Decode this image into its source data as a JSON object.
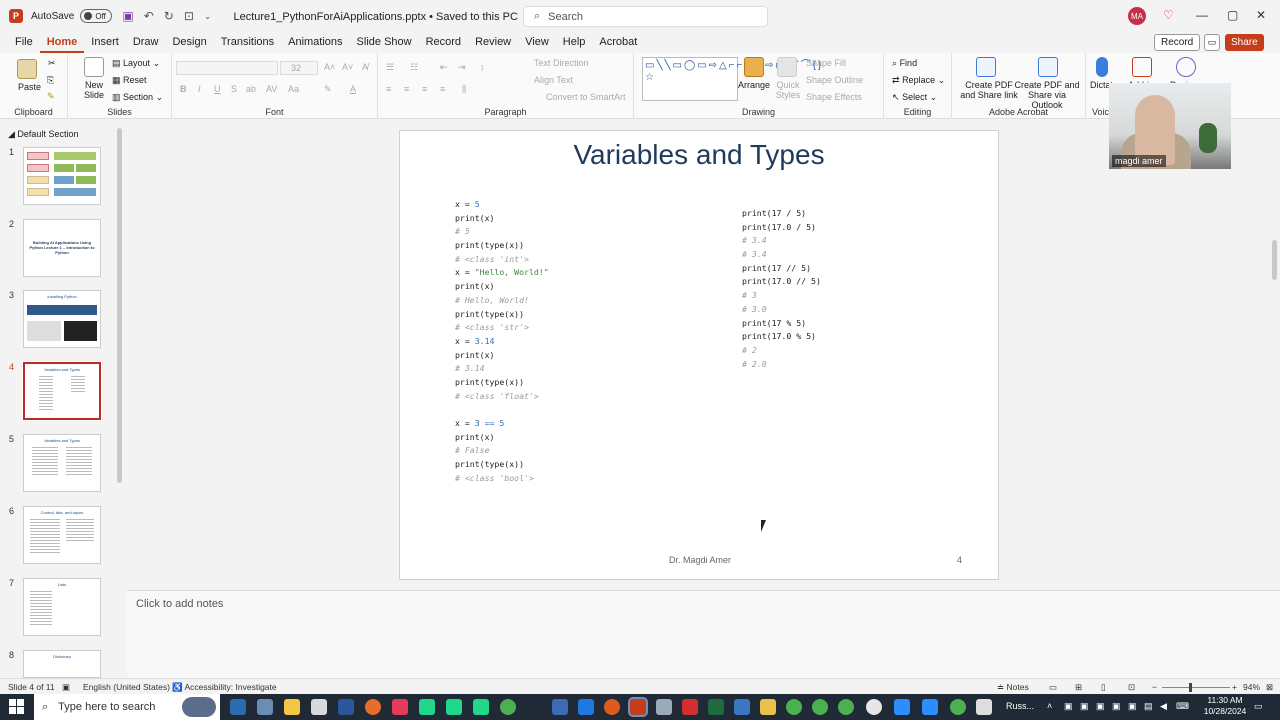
{
  "titlebar": {
    "autosave_label": "AutoSave",
    "autosave_state": "Off",
    "doc_title": "Lecture1_PythonForAiApplications.pptx  •  Saved to this PC  ⌄",
    "search_placeholder": "Search",
    "user_initials": "MA"
  },
  "tabs": [
    "File",
    "Home",
    "Insert",
    "Draw",
    "Design",
    "Transitions",
    "Animations",
    "Slide Show",
    "Record",
    "Review",
    "View",
    "Help",
    "Acrobat"
  ],
  "active_tab": "Home",
  "tab_actions": {
    "record": "Record",
    "share": "Share"
  },
  "ribbon": {
    "clipboard": {
      "label": "Clipboard",
      "paste": "Paste"
    },
    "slides": {
      "label": "Slides",
      "new_slide": "New Slide",
      "layout": "Layout",
      "reset": "Reset",
      "section": "Section"
    },
    "font": {
      "label": "Font",
      "size": "32"
    },
    "paragraph": {
      "label": "Paragraph",
      "text_direction": "Text Direction",
      "align_text": "Align Text",
      "smartart": "Convert to SmartArt"
    },
    "drawing": {
      "label": "Drawing",
      "arrange": "Arrange",
      "quick_styles": "Quick Styles",
      "shape_fill": "Shape Fill",
      "shape_outline": "Shape Outline",
      "shape_effects": "Shape Effects"
    },
    "editing": {
      "label": "Editing",
      "find": "Find",
      "replace": "Replace",
      "select": "Select"
    },
    "acrobat": {
      "label": "Adobe Acrobat",
      "create_pdf_share": "Create PDF and Share link",
      "create_pdf_outlook": "Create PDF and Share via Outlook"
    },
    "voice": {
      "label": "Voice",
      "dictate": "Dictate",
      "addins": "Add-ins",
      "designer": "Designer"
    }
  },
  "thumbnails": {
    "section": "Default Section",
    "slides": [
      {
        "num": "1",
        "title": ""
      },
      {
        "num": "2",
        "title": "Building AI Applications Using Python Lecture 1 – Introduction to Python"
      },
      {
        "num": "3",
        "title": "Installing Python"
      },
      {
        "num": "4",
        "title": "Variables and Types"
      },
      {
        "num": "5",
        "title": "Variables and Types"
      },
      {
        "num": "6",
        "title": "Control, lists, and tuples"
      },
      {
        "num": "7",
        "title": "Lists"
      },
      {
        "num": "8",
        "title": "Dictionary"
      }
    ],
    "active": "4"
  },
  "slide": {
    "title": "Variables and Types",
    "left_code": [
      {
        "t": "x = ",
        "n": "5"
      },
      {
        "t": "print(x)"
      },
      {
        "c": "# 5"
      },
      {
        "t": "print(type(x))"
      },
      {
        "c": "# <class 'int'>"
      },
      {
        "t": "x = ",
        "s": "\"Hello, World!\""
      },
      {
        "t": "print(x)"
      },
      {
        "c": "# Hello, World!"
      },
      {
        "t": "print(type(x))"
      },
      {
        "c": "# <class 'str'>"
      },
      {
        "t": "x = ",
        "n": "3.14"
      },
      {
        "t": "print(x)"
      },
      {
        "c": "# 3.14"
      },
      {
        "t": "print(type(x))"
      },
      {
        "c": "# <class 'float'>"
      },
      {
        "t": ""
      },
      {
        "t": "x = ",
        "n": "3 == 5"
      },
      {
        "t": "print(x)"
      },
      {
        "c": "# False"
      },
      {
        "t": "print(type(x))"
      },
      {
        "c": "# <class 'bool'>"
      }
    ],
    "right_code": [
      {
        "t": "print(17 / 5)"
      },
      {
        "t": "print(17.0 / 5)"
      },
      {
        "c": "# 3.4"
      },
      {
        "c": "# 3.4"
      },
      {
        "t": "print(17 // 5)"
      },
      {
        "t": "print(17.0 // 5)"
      },
      {
        "c": "# 3"
      },
      {
        "c": "# 3.0"
      },
      {
        "t": "print(17 % 5)"
      },
      {
        "t": "print(17.0 % 5)"
      },
      {
        "c": "# 2"
      },
      {
        "c": "# 2.0"
      }
    ],
    "footer": "Dr. Magdi Amer",
    "page_number": "4"
  },
  "webcam": {
    "name": "magdi amer"
  },
  "notes": {
    "placeholder": "Click to add notes"
  },
  "status": {
    "slide_of": "Slide 4 of 11",
    "language": "English (United States)",
    "accessibility": "Accessibility: Investigate",
    "notes": "Notes",
    "zoom": "94%"
  },
  "taskbar": {
    "search_placeholder": "Type here to search",
    "lang": "Russ...",
    "time": "11:30 AM",
    "date": "10/28/2024"
  }
}
